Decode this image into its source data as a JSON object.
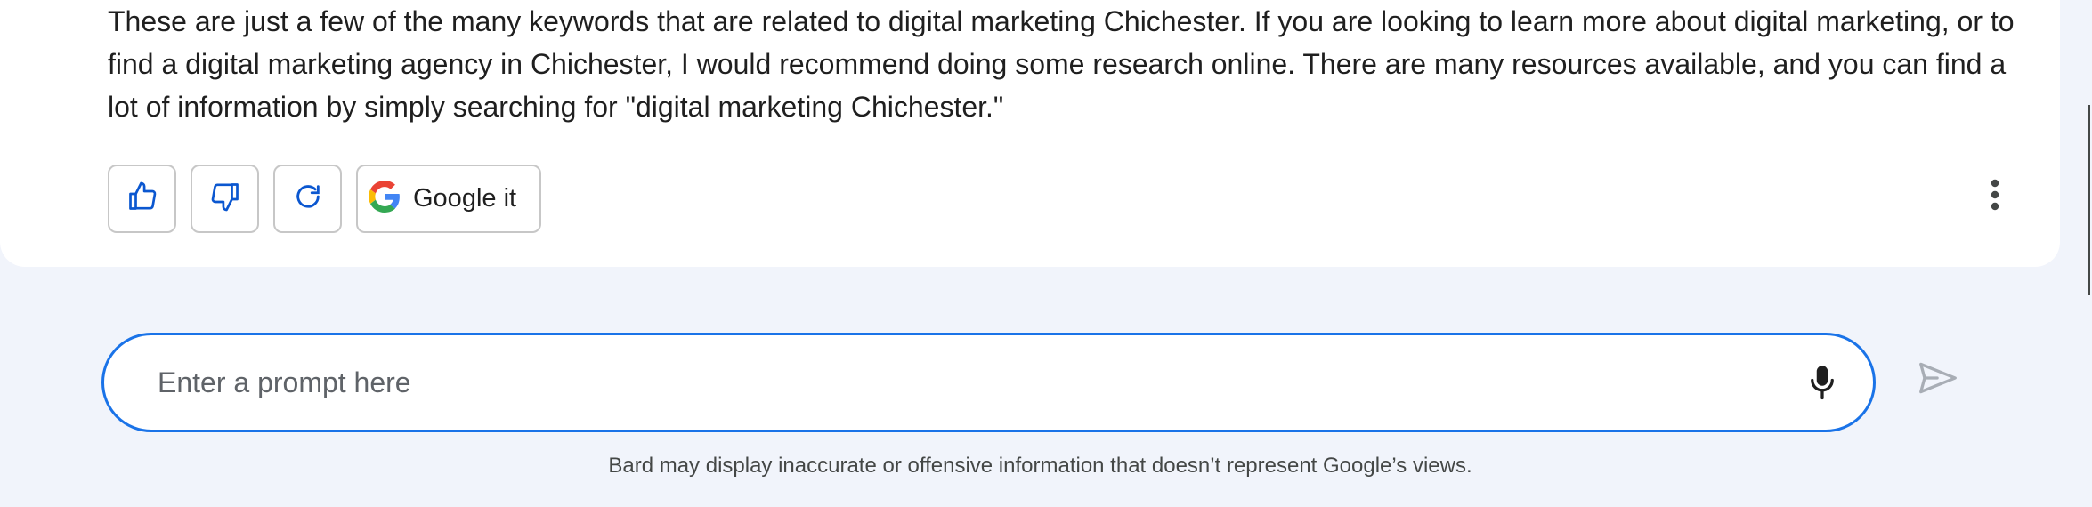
{
  "response": {
    "text": "These are just a few of the many keywords that are related to digital marketing Chichester. If you are looking to learn more about digital marketing, or to find a digital marketing agency in Chichester, I would recommend doing some research online. There are many resources available, and you can find a lot of information by simply searching for \"digital marketing Chichester.\""
  },
  "actions": {
    "thumbs_up_icon": "thumbs-up-icon",
    "thumbs_down_icon": "thumbs-down-icon",
    "regenerate_icon": "refresh-icon",
    "google_it_label": "Google it",
    "more_icon": "more-vert-icon"
  },
  "prompt": {
    "placeholder": "Enter a prompt here",
    "value": "",
    "mic_icon": "mic-icon",
    "send_icon": "send-icon"
  },
  "disclaimer": "Bard may display inaccurate or offensive information that doesn’t represent Google’s views.",
  "colors": {
    "accent": "#1a73e8",
    "icon_blue": "#0b57d0",
    "page_bg": "#f1f4fb"
  }
}
